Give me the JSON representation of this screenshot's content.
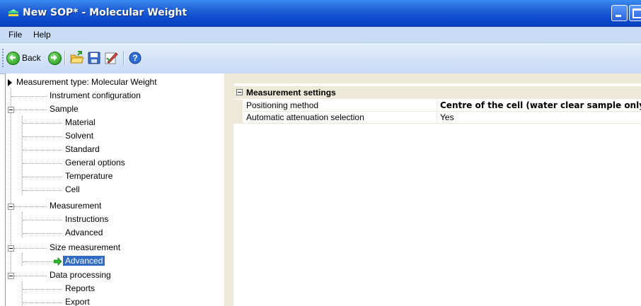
{
  "window": {
    "title": "New SOP* - Molecular Weight",
    "accent_color": "#0b4bd0"
  },
  "menu": {
    "items": [
      "File",
      "Help"
    ]
  },
  "toolbar": {
    "back_label": "Back"
  },
  "tree": {
    "nodes": [
      {
        "label": "Measurement type: Molecular Weight",
        "level": 0
      },
      {
        "label": "Instrument configuration",
        "level": 1
      },
      {
        "label": "Sample",
        "level": 1,
        "expanded": true
      },
      {
        "label": "Material",
        "level": 2
      },
      {
        "label": "Solvent",
        "level": 2
      },
      {
        "label": "Standard",
        "level": 2
      },
      {
        "label": "General options",
        "level": 2
      },
      {
        "label": "Temperature",
        "level": 2
      },
      {
        "label": "Cell",
        "level": 2
      },
      {
        "label": "Measurement",
        "level": 1,
        "expanded": true
      },
      {
        "label": "Instructions",
        "level": 2
      },
      {
        "label": "Advanced",
        "level": 2
      },
      {
        "label": "Size measurement",
        "level": 1,
        "expanded": true
      },
      {
        "label": "Advanced",
        "level": 2,
        "selected": true
      },
      {
        "label": "Data processing",
        "level": 1,
        "expanded": true
      },
      {
        "label": "Reports",
        "level": 2
      },
      {
        "label": "Export",
        "level": 2
      }
    ],
    "selection_color": "#316ac5"
  },
  "property_grid": {
    "category": "Measurement settings",
    "rows": [
      {
        "name": "Positioning method",
        "value": "Centre of the cell (water clear sample only)",
        "bold": true
      },
      {
        "name": "Automatic attenuation selection",
        "value": "Yes",
        "bold": false
      }
    ]
  }
}
